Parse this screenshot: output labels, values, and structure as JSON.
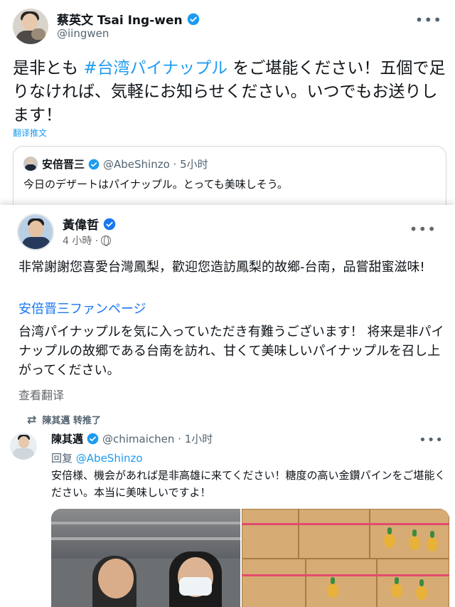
{
  "tweet1": {
    "name": "蔡英文 Tsai Ing-wen",
    "handle": "@iingwen",
    "more": "•••",
    "text_before": "是非とも ",
    "hashtag": "#台湾パイナップル",
    "text_after": " をご堪能ください！五個で足りなければ、気軽にお知らせください。いつでもお送りします！",
    "translate": "翻译推文",
    "quote": {
      "name": "安倍晋三",
      "meta": "@AbeShinzo · 5小时",
      "text": "今日のデザートはパイナップル。とっても美味しそう。"
    }
  },
  "fb_post": {
    "name": "黃偉哲",
    "time": "4 小時 ·",
    "more": "•••",
    "text1": "非常謝謝您喜愛台灣鳳梨，歡迎您造訪鳳梨的故鄉-台南，品嘗甜蜜滋味!",
    "page_link": "安倍晋三ファンページ",
    "text2": "台湾パイナップルを気に入っていただき有難うございます！ 将来是非パイナップルの故郷である台南を訪れ、甘くて美味しいパイナップルを召し上がってください。",
    "translate": "查看翻译"
  },
  "tweet2": {
    "retweet_label": "陳其邁 转推了",
    "name": "陳其邁",
    "meta": "@chimaichen · 1小时",
    "reply_prefix": "回复 ",
    "reply_to": "@AbeShinzo",
    "text": "安倍様、機会があれば是非高雄に来てください！糖度の高い金鑽パインをご堪能ください。本当に美味しいですよ！",
    "more": "•••"
  },
  "colors": {
    "link_twitter": "#1d9bf0",
    "link_facebook": "#1877f2",
    "text": "#0f1419",
    "muted": "#536471"
  }
}
